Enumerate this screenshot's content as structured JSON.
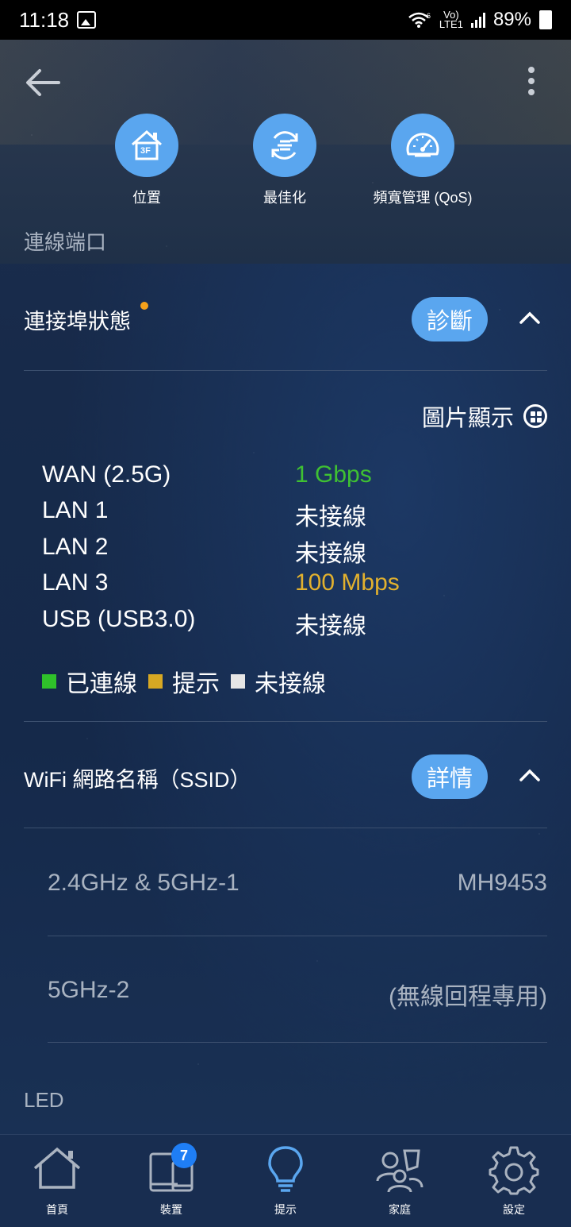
{
  "status_bar": {
    "time": "11:18",
    "battery": "89%",
    "volte_top": "Vo)",
    "volte_bottom": "LTE1",
    "wifi_tag": "6"
  },
  "quick_actions": [
    {
      "label": "位置",
      "icon": "home-3f-icon",
      "badge": "3F"
    },
    {
      "label": "最佳化",
      "icon": "optimize-icon"
    },
    {
      "label": "頻寬管理 (QoS)",
      "icon": "speedometer-icon"
    }
  ],
  "section_title": "連線端口",
  "port_status": {
    "title": "連接埠狀態",
    "diagnose_label": "診斷",
    "view_toggle_label": "圖片顯示",
    "ports": [
      {
        "name": "WAN (2.5G)",
        "value": "1 Gbps",
        "color": "#3fc132"
      },
      {
        "name": "LAN 1",
        "value": "未接線",
        "color": "#ffffff"
      },
      {
        "name": "LAN 2",
        "value": "未接線",
        "color": "#ffffff"
      },
      {
        "name": "LAN 3",
        "value": "100 Mbps",
        "color": "#e2b12e"
      },
      {
        "name": "USB (USB3.0)",
        "value": "未接線",
        "color": "#ffffff"
      }
    ],
    "legend": [
      {
        "label": "已連線",
        "color": "#2fc12a"
      },
      {
        "label": "提示",
        "color": "#d7a823"
      },
      {
        "label": "未接線",
        "color": "#e6e6e6"
      }
    ]
  },
  "wifi": {
    "title": "WiFi 網路名稱（SSID）",
    "details_label": "詳情",
    "rows": [
      {
        "band": "2.4GHz & 5GHz-1",
        "ssid": "MH9453"
      },
      {
        "band": "5GHz-2",
        "ssid": "(無線回程專用)"
      }
    ]
  },
  "led_label": "LED",
  "bottom_nav": {
    "items": [
      {
        "label": "首頁",
        "icon": "home-icon"
      },
      {
        "label": "裝置",
        "icon": "devices-icon",
        "badge": "7"
      },
      {
        "label": "提示",
        "icon": "lightbulb-icon",
        "active": true
      },
      {
        "label": "家庭",
        "icon": "family-icon"
      },
      {
        "label": "設定",
        "icon": "gear-icon"
      }
    ]
  }
}
